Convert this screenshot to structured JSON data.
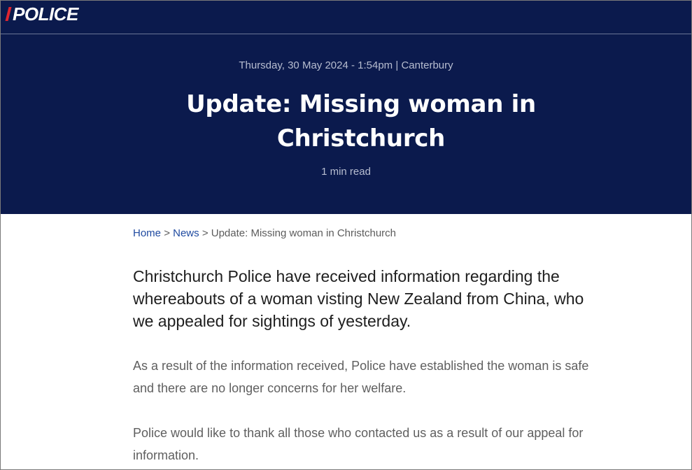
{
  "header": {
    "logo_text": "POLICE",
    "date": "Thursday, 30 May 2024 - 1:54pm",
    "separator": "|",
    "region": "Canterbury",
    "title": "Update: Missing woman in Christchurch",
    "read_time": "1 min read"
  },
  "breadcrumb": {
    "home": "Home",
    "sep": ">",
    "news": "News",
    "current": "Update: Missing woman in Christchurch"
  },
  "article": {
    "lead": "Christchurch Police have received information regarding the whereabouts of a woman visting New Zealand from China, who we appealed for sightings of yesterday.",
    "paragraphs": [
      "As a result of the information received, Police have established the woman is safe and there are no longer concerns for her welfare.",
      "Police would like to thank all those who contacted us as a result of our appeal for information."
    ]
  },
  "colors": {
    "header_bg": "#0b1a4d",
    "logo_accent": "#e0252f",
    "link": "#1f4aa0"
  }
}
